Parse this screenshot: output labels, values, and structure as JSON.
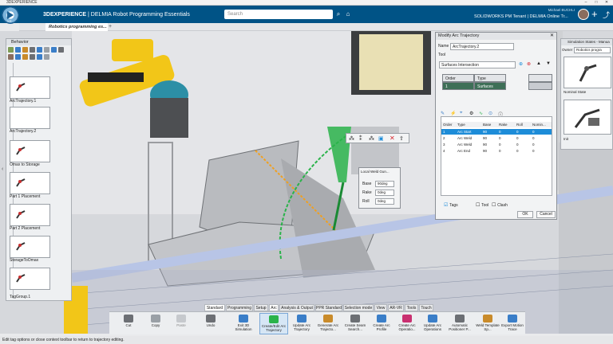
{
  "window": {
    "title": "3DEXPERIENCE"
  },
  "topbar": {
    "app_brand": "3DEXPERIENCE",
    "app_rest": " | DELMIA Robot Programming Essentials",
    "compass_badge": "V.R",
    "search_placeholder": "Search",
    "user": "Michael BUCHLI",
    "tenant": "SOLIDWORKS PM Tenant | DELMIA Online Tr..."
  },
  "tabs": [
    {
      "label": "Robotics programming es..."
    }
  ],
  "behavior": {
    "title": "Behavior",
    "items": [
      {
        "label": "ArcTrajectory.1"
      },
      {
        "label": "ArcTrajectory.2"
      },
      {
        "label": "Omax to Storage"
      },
      {
        "label": "Part 1 Placement"
      },
      {
        "label": "Part 2 Placement"
      },
      {
        "label": "StorageToOmax"
      }
    ],
    "group": "TagGroup.1"
  },
  "modify_dialog": {
    "title": "Modify Arc Trajectory",
    "name_label": "Name",
    "name_value": "ArcTrajectory.2",
    "tool_label": "Tool",
    "method_value": "Surfaces Intersection",
    "grid_headers": [
      "Order",
      "Type"
    ],
    "grid_row": [
      "1",
      "Surfaces"
    ],
    "table_headers": [
      "Order",
      "Type",
      "Base",
      "Rake",
      "Roll",
      "Nomin..."
    ],
    "rows": [
      {
        "order": "1",
        "type": "Arc Start",
        "base": "90",
        "rake": "0",
        "roll": "0",
        "nom": "0",
        "selected": true
      },
      {
        "order": "2",
        "type": "Arc Weld",
        "base": "90",
        "rake": "0",
        "roll": "0",
        "nom": "0",
        "selected": false
      },
      {
        "order": "3",
        "type": "Arc Weld",
        "base": "90",
        "rake": "0",
        "roll": "0",
        "nom": "0",
        "selected": false
      },
      {
        "order": "4",
        "type": "Arc End",
        "base": "90",
        "rake": "0",
        "roll": "0",
        "nom": "0",
        "selected": false
      }
    ],
    "tags_label": "Tags",
    "tool_check_label": "Tool",
    "clash_label": "Clash",
    "ok": "OK",
    "cancel": "Cancel"
  },
  "sim_states": {
    "title": "Simulation States - Manua",
    "owner_label": "Owner",
    "owner_value": "Robotics progra",
    "states": [
      {
        "label": "Nominal State"
      },
      {
        "label": "Init"
      }
    ]
  },
  "local_weld": {
    "title": "Local Weld Gun...",
    "fields": [
      {
        "label": "Base",
        "value": "90deg"
      },
      {
        "label": "Rake",
        "value": "0deg"
      },
      {
        "label": "Roll",
        "value": "0deg"
      }
    ]
  },
  "bottom_tabs": [
    "Standard",
    "Programming",
    "Setup",
    "Arc",
    "Analysis & Output",
    "PPR Standard",
    "Selection mode",
    "View",
    "AR-VR",
    "Tools",
    "Touch"
  ],
  "toolbar": [
    {
      "label": "Cut"
    },
    {
      "label": "Copy"
    },
    {
      "label": "Paste"
    },
    {
      "label": "Undo"
    },
    {
      "label": "Exit 3D Simulation"
    },
    {
      "label": "Create/Edit Arc Trajectory"
    },
    {
      "label": "Update Arc Trajectory"
    },
    {
      "label": "Generate Arc Trajecto..."
    },
    {
      "label": "Create Seam Search..."
    },
    {
      "label": "Create Arc Profile"
    },
    {
      "label": "Create Arc Operatio..."
    },
    {
      "label": "Update Arc Operations"
    },
    {
      "label": "Automatic Positioner P..."
    },
    {
      "label": "Weld Template Sp..."
    },
    {
      "label": "Export Motion Trace"
    }
  ],
  "status": "Edit tag options or close context toolbar to return to trajectory editing.",
  "colors": {
    "topbar": "#005386",
    "accent": "#1d8cd8",
    "weld_path": "#2ab34a",
    "robot": "#f2c618"
  }
}
